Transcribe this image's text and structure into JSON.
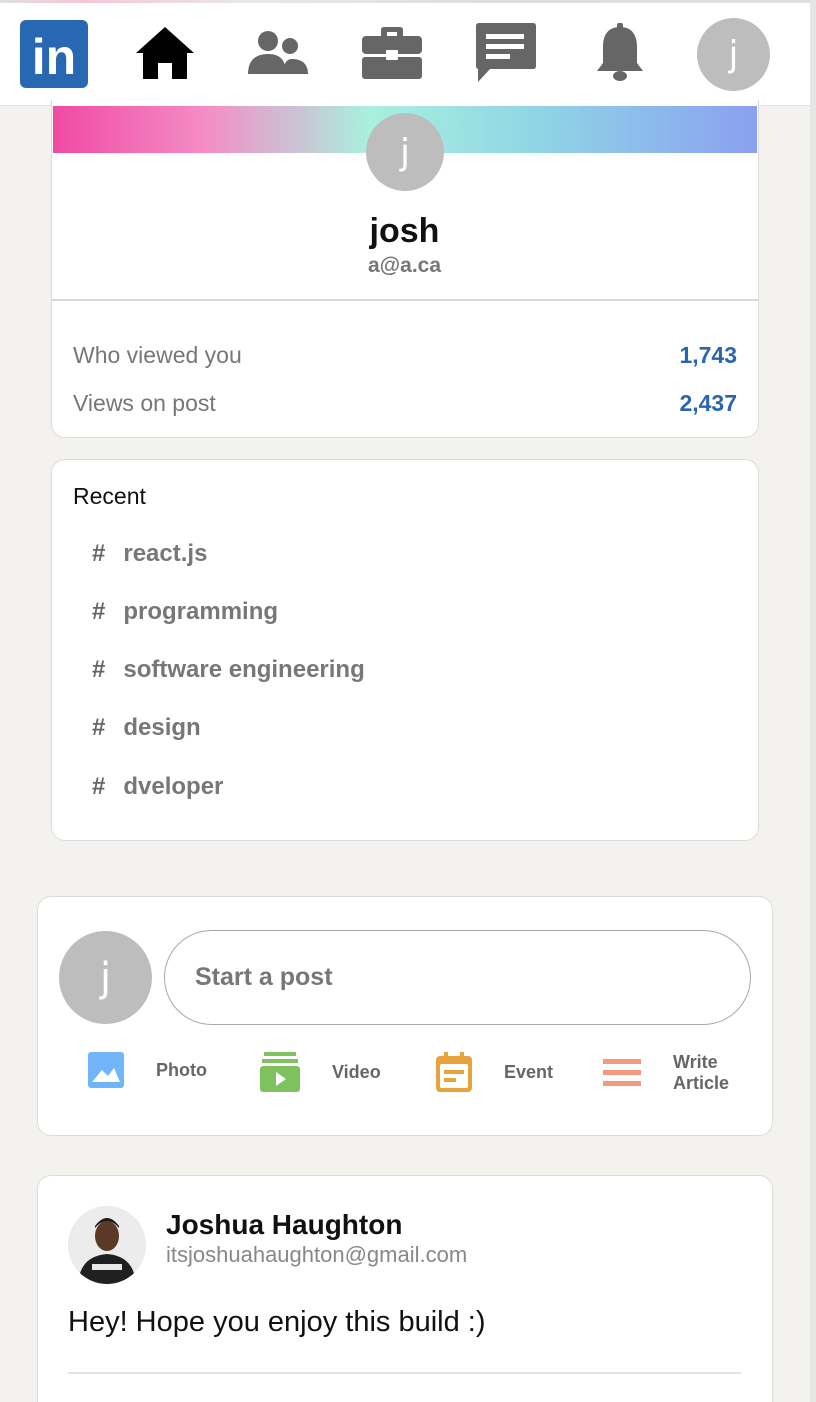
{
  "nav": {
    "logo_text": "in",
    "avatar_letter": "j",
    "items": [
      "home-icon",
      "network-icon",
      "jobs-icon",
      "messaging-icon",
      "notifications-icon"
    ]
  },
  "profile": {
    "avatar_letter": "j",
    "name": "josh",
    "email": "a@a.ca",
    "stats": [
      {
        "label": "Who viewed you",
        "value": "1,743"
      },
      {
        "label": "Views on post",
        "value": "2,437"
      }
    ],
    "stat_color": "#2a66b0"
  },
  "recent": {
    "title": "Recent",
    "hash": "#",
    "items": [
      "react.js",
      "programming",
      "software engineering",
      "design",
      "dveloper"
    ]
  },
  "composer": {
    "avatar_letter": "j",
    "placeholder": "Start a post",
    "actions": [
      {
        "label": "Photo",
        "icon": "photo-icon",
        "color": "#70b5f9"
      },
      {
        "label": "Video",
        "icon": "video-icon",
        "color": "#7fc15e"
      },
      {
        "label": "Event",
        "icon": "event-icon",
        "color": "#e7a33e"
      },
      {
        "label_line1": "Write",
        "label_line2": "Article",
        "icon": "article-icon",
        "color": "#f5987e"
      }
    ]
  },
  "feed": {
    "posts": [
      {
        "name": "Joshua Haughton",
        "email": "itsjoshuahaughton@gmail.com",
        "text": "Hey! Hope you enjoy this build :)"
      }
    ]
  },
  "colors": {
    "brand": "#2867b2",
    "background": "#f3f2ef"
  }
}
